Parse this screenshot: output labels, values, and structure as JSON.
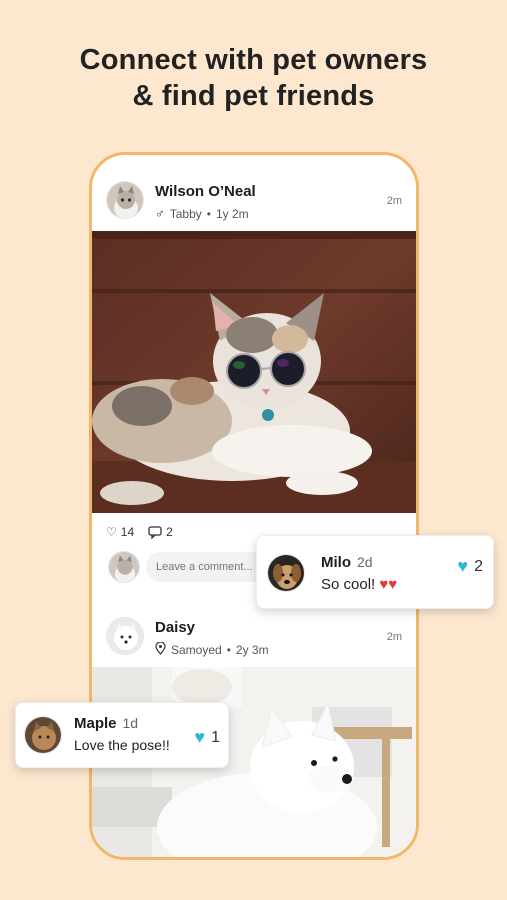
{
  "headline": {
    "line1": "Connect with pet owners",
    "line2": "& find pet friends"
  },
  "posts": [
    {
      "name": "Wilson O’Neal",
      "gender_icon": "♂",
      "breed": "Tabby",
      "age": "1y 2m",
      "time": "2m",
      "likes": "14",
      "comments": "2",
      "comment_placeholder": "Leave a comment..."
    },
    {
      "name": "Daisy",
      "breed": "Samoyed",
      "age": "2y 3m",
      "time": "2m"
    }
  ],
  "comments": [
    {
      "name": "Milo",
      "age": "2d",
      "text": "So cool!",
      "emoji": "♥♥",
      "likes": "2"
    },
    {
      "name": "Maple",
      "age": "1d",
      "text": "Love the pose!!",
      "likes": "1"
    }
  ],
  "colors": {
    "background": "#fde8cf",
    "phone_border": "#f2b76a",
    "like_blue": "#2fb5d6"
  }
}
